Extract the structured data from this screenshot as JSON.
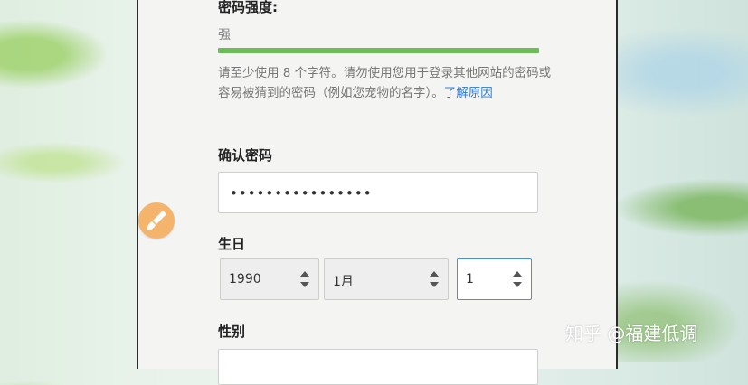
{
  "form": {
    "strength_label": "密码强度:",
    "strength_value": "强",
    "strength_level": 1.0,
    "strength_color": "#6cbd57",
    "help_text": "请至少使用 8 个字符。请勿使用您用于登录其他网站的密码或容易被猜到的密码（例如您宠物的名字）。",
    "help_link": "了解原因",
    "confirm_label": "确认密码",
    "confirm_value": "••••••••••••••••",
    "birthday_label": "生日",
    "birth_year": "1990",
    "birth_month": "1月",
    "birth_day": "1",
    "gender_label": "性别"
  },
  "overlay": {
    "brush_icon": "paintbrush-icon",
    "brush_color": "#f4b46b"
  },
  "watermark": "知乎 @福建低调"
}
